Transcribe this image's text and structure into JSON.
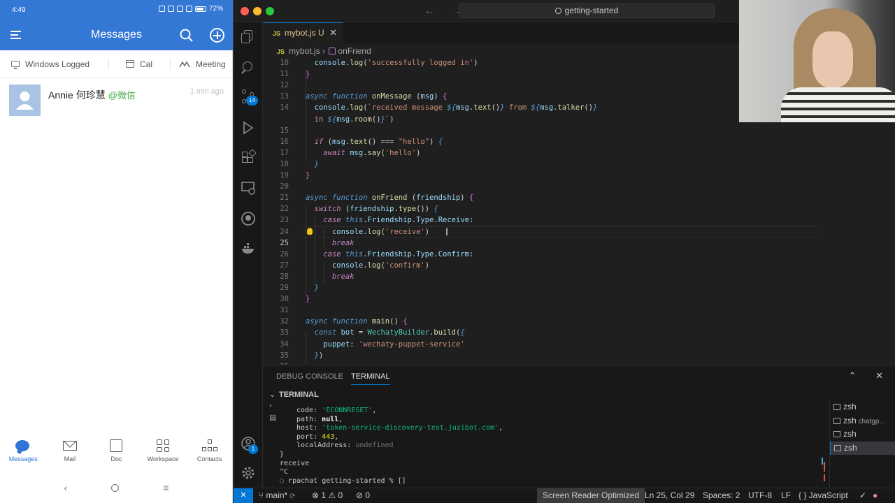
{
  "phone": {
    "status": {
      "time": "4:49",
      "battery": "72%"
    },
    "header": {
      "title": "Messages"
    },
    "quick_tabs": [
      {
        "label": "Windows Logged"
      },
      {
        "label": "Cal"
      },
      {
        "label": "Meeting"
      }
    ],
    "messages": [
      {
        "name": "Annie 何珍慧",
        "tag": "@微信",
        "time": "1 min ago"
      }
    ],
    "bottom_nav": [
      {
        "label": "Messages"
      },
      {
        "label": "Mail"
      },
      {
        "label": "Doc"
      },
      {
        "label": "Workspace"
      },
      {
        "label": "Contacts"
      }
    ],
    "system_nav": {
      "back": "‹",
      "menu": "≡"
    }
  },
  "vscode": {
    "title_search": "getting-started",
    "nav_arrows": "← →",
    "activity_badges": {
      "scm": "14",
      "accounts": "1"
    },
    "tab": {
      "file_badge": "JS",
      "filename": "mybot.js",
      "status": "U",
      "close": "✕"
    },
    "breadcrumb": {
      "file_badge": "JS",
      "file": "mybot.js",
      "separator": "›",
      "symbol": "onFriend"
    },
    "editor": {
      "lines": [
        {
          "n": "10",
          "html": "  <span class=\"v\">console</span>.<span class=\"f\">log</span>(<span class=\"s\">'successfully logged in'</span>)"
        },
        {
          "n": "11",
          "html": "<span class=\"p\">}</span>"
        },
        {
          "n": "12",
          "html": ""
        },
        {
          "n": "13",
          "html": "<span class=\"k\">async</span> <span class=\"k\">function</span> <span class=\"f\">onMessage</span> (<span class=\"v\">msg</span>) <span class=\"p\">{</span>"
        },
        {
          "n": "14",
          "html": "  <span class=\"v\">console</span>.<span class=\"f\">log</span>(<span class=\"s\">`received message </span><span class=\"k\">${</span><span class=\"v\">msg</span>.<span class=\"f\">text</span>()<span class=\"k\">}</span><span class=\"s\"> from </span><span class=\"k\">${</span><span class=\"v\">msg</span>.<span class=\"f\">talker</span>()<span class=\"k\">}</span>"
        },
        {
          "n": "",
          "html": "  <span class=\"s\">in </span><span class=\"k\">${</span><span class=\"v\">msg</span>.<span class=\"f\">room</span>()<span class=\"k\">}</span><span class=\"s\">`</span>)"
        },
        {
          "n": "15",
          "html": ""
        },
        {
          "n": "16",
          "html": "  <span class=\"kc\">if</span> (<span class=\"v\">msg</span>.<span class=\"f\">text</span>() === <span class=\"s\">\"hello\"</span>) <span class=\"k\">{</span>"
        },
        {
          "n": "17",
          "html": "    <span class=\"kc\">await</span> <span class=\"v\">msg</span>.<span class=\"f\">say</span>(<span class=\"s\">'hello'</span>)"
        },
        {
          "n": "18",
          "html": "  <span class=\"k\">}</span>"
        },
        {
          "n": "19",
          "html": "<span class=\"p\">}</span>"
        },
        {
          "n": "20",
          "html": ""
        },
        {
          "n": "21",
          "html": "<span class=\"k\">async</span> <span class=\"k\">function</span> <span class=\"f\">onFriend</span> (<span class=\"v\">friendship</span>) <span class=\"p\">{</span>"
        },
        {
          "n": "22",
          "html": "  <span class=\"kc\">switch</span> (<span class=\"v\">friendship</span>.<span class=\"f\">type</span>()) <span class=\"k\">{</span>"
        },
        {
          "n": "23",
          "html": "    <span class=\"kc\">case</span> <span class=\"k\">this</span>.<span class=\"v\">Friendship</span>.<span class=\"v\">Type</span>.<span class=\"v\">Receive</span>:"
        },
        {
          "n": "24",
          "html": "      <span class=\"v\">console</span>.<span class=\"f\">log</span>(<span class=\"s\">'receive'</span>)"
        },
        {
          "n": "25",
          "html": "      <span class=\"kc\">break</span>"
        },
        {
          "n": "26",
          "html": "    <span class=\"kc\">case</span> <span class=\"k\">this</span>.<span class=\"v\">Friendship</span>.<span class=\"v\">Type</span>.<span class=\"v\">Confirm</span>:"
        },
        {
          "n": "27",
          "html": "      <span class=\"v\">console</span>.<span class=\"f\">log</span>(<span class=\"s\">'confirm'</span>)"
        },
        {
          "n": "28",
          "html": "      <span class=\"kc\">break</span>"
        },
        {
          "n": "29",
          "html": "  <span class=\"k\">}</span>"
        },
        {
          "n": "30",
          "html": "<span class=\"p\">}</span>"
        },
        {
          "n": "31",
          "html": ""
        },
        {
          "n": "32",
          "html": "<span class=\"k\">async</span> <span class=\"k\">function</span> <span class=\"f\">main</span>() <span class=\"p\">{</span>"
        },
        {
          "n": "33",
          "html": "  <span class=\"k\">const</span> <span class=\"v\">bot</span> = <span class=\"t\">WechatyBuilder</span>.<span class=\"f\">build</span>(<span class=\"k\">{</span>"
        },
        {
          "n": "34",
          "html": "    <span class=\"v\">puppet</span>: <span class=\"s\">'wechaty-puppet-service'</span>"
        },
        {
          "n": "35",
          "html": "  <span class=\"k\">}</span>)"
        },
        {
          "n": "36",
          "html": ""
        }
      ],
      "active_line": "25"
    },
    "panel": {
      "tabs": [
        "DEBUG CONSOLE",
        "TERMINAL"
      ],
      "active_tab": "TERMINAL",
      "section_title": "TERMINAL",
      "icons": "⌃ ✕",
      "terminal_lines": [
        "<span class=\"tk\">  code: </span><span class=\"tstr\">'ECONNRESET'</span>,",
        "<span class=\"tk\">  path: </span><span class=\"tb\">null</span>,",
        "<span class=\"tk\">  host: </span><span class=\"tstr\">'token-service-discovery-test.juzibot.com'</span>,",
        "<span class=\"tk\">  port: </span><span class=\"tnum\">443</span>,",
        "<span class=\"tk\">  localAddress: </span><span class=\"tdim\">undefined</span>",
        "}",
        "receive",
        "^C",
        "<span class=\"tdim\">○</span> rpachat getting-started % []"
      ],
      "terminals": [
        {
          "label": "zsh",
          "sub": ""
        },
        {
          "label": "zsh",
          "sub": "chatgp..."
        },
        {
          "label": "zsh",
          "sub": ""
        },
        {
          "label": "zsh",
          "sub": ""
        }
      ]
    },
    "statusbar": {
      "remote": "✕",
      "branch": "main*",
      "sync": "⟳",
      "problems": "⊗ 1 ⚠ 0",
      "ports": "⊘ 0",
      "screen_reader": "Screen Reader Optimized",
      "position": "Ln 25, Col 29",
      "spaces": "Spaces: 2",
      "encoding": "UTF-8",
      "eol": "LF",
      "language": "{ } JavaScript"
    }
  },
  "colors": {
    "phone_accent": "#3478d6",
    "vscode_accent": "#0078d4",
    "wechat_tag": "#4caf50"
  }
}
